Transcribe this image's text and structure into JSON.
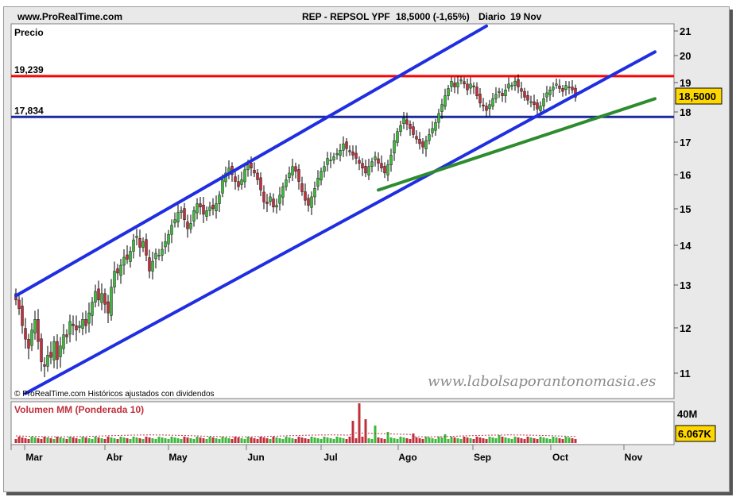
{
  "header": {
    "site": "www.ProRealTime.com",
    "ticker": "REP - REPSOL YPF",
    "quote": "18,5000 (-1,65%)",
    "period": "Diario",
    "date": "19 Nov"
  },
  "price_panel": {
    "label": "Precio",
    "footer": "© ProRealTime.com Históricos ajustados con dividendos",
    "watermark": "www.labolsaporantonomasia.es"
  },
  "volume_panel": {
    "label": "Volumen MM (Ponderada 10)",
    "scale_label": "40M",
    "last_label": "6.067K"
  },
  "colors": {
    "up": "#3db83d",
    "down": "#c0303c",
    "channel": "#1f2ee0",
    "resistance": "#ff0000",
    "support": "#1c2a9c",
    "trend": "#2e8b2e",
    "last_box": "#ffd700"
  },
  "chart_data": {
    "type": "candlestick",
    "x_axis_labels": [
      "Mar",
      "Abr",
      "May",
      "Jun",
      "Jul",
      "Ago",
      "Sep",
      "Oct",
      "Nov"
    ],
    "y_axis_ticks": [
      11,
      12,
      13,
      14,
      15,
      16,
      17,
      18,
      19,
      20,
      21
    ],
    "y_range": [
      10.5,
      21.2
    ],
    "last_price": "18,5000",
    "levels": [
      {
        "label": "19,239",
        "value": 19.239,
        "color": "#ff0000"
      },
      {
        "label": "17,834",
        "value": 17.834,
        "color": "#1c2a9c"
      }
    ],
    "trendlines": [
      {
        "name": "channel-upper",
        "from": [
          0,
          12.75
        ],
        "to": [
          148,
          21.2
        ]
      },
      {
        "name": "channel-lower",
        "from": [
          3,
          10.55
        ],
        "to": [
          201,
          20.15
        ]
      },
      {
        "name": "green-support",
        "from": [
          114,
          15.55
        ],
        "to": [
          201,
          18.45
        ]
      }
    ],
    "closes": [
      12.65,
      12.45,
      12.05,
      11.75,
      11.55,
      11.95,
      12.2,
      11.7,
      11.25,
      11.15,
      11.4,
      11.35,
      11.7,
      11.3,
      11.6,
      11.85,
      11.8,
      12.15,
      12.05,
      11.95,
      12.05,
      12.2,
      12.05,
      12.35,
      12.6,
      12.85,
      12.65,
      12.8,
      12.55,
      12.35,
      12.95,
      13.35,
      13.3,
      13.5,
      13.7,
      13.65,
      13.85,
      14.15,
      14.25,
      13.95,
      14.1,
      13.75,
      13.35,
      13.6,
      13.8,
      13.75,
      13.9,
      14.1,
      14.3,
      14.55,
      14.7,
      14.9,
      14.95,
      14.7,
      14.45,
      14.6,
      14.95,
      15.15,
      15.05,
      14.85,
      14.95,
      15.05,
      15.0,
      15.15,
      15.4,
      15.85,
      16.05,
      16.2,
      16.0,
      15.8,
      15.65,
      15.85,
      16.15,
      16.3,
      16.2,
      16.05,
      15.85,
      15.55,
      15.2,
      15.15,
      15.35,
      15.05,
      15.1,
      15.4,
      15.65,
      15.85,
      16.05,
      16.25,
      16.1,
      15.8,
      15.5,
      15.25,
      15.1,
      15.35,
      15.6,
      15.9,
      16.1,
      16.25,
      16.5,
      16.45,
      16.55,
      16.65,
      16.75,
      16.95,
      16.8,
      16.7,
      16.6,
      16.5,
      16.35,
      16.2,
      16.05,
      16.25,
      16.4,
      16.55,
      16.35,
      16.2,
      16.05,
      16.3,
      16.6,
      17.05,
      17.35,
      17.55,
      17.8,
      17.6,
      17.45,
      17.25,
      17.1,
      16.95,
      16.85,
      17.05,
      17.25,
      17.45,
      17.65,
      17.95,
      18.25,
      18.55,
      18.8,
      19.05,
      18.85,
      19.0,
      19.1,
      18.95,
      18.75,
      18.95,
      18.85,
      18.55,
      18.3,
      18.2,
      18.05,
      18.25,
      18.45,
      18.6,
      18.7,
      18.55,
      18.75,
      18.95,
      18.9,
      19.05,
      18.85,
      18.7,
      18.5,
      18.4,
      18.35,
      18.25,
      18.1,
      18.2,
      18.45,
      18.65,
      18.75,
      18.85,
      18.95,
      18.8,
      18.7,
      18.9,
      18.85,
      18.75,
      18.5
    ],
    "volume_level": 6.067
  }
}
